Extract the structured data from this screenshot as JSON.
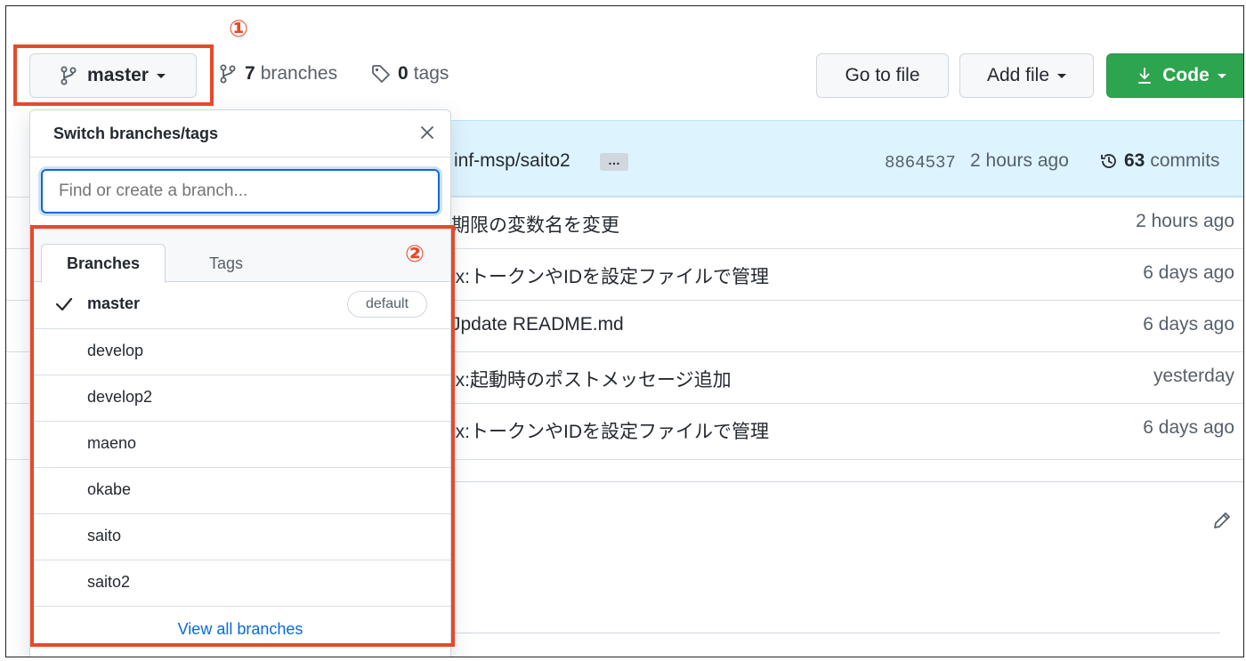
{
  "annotations": {
    "marker1": "①",
    "marker2": "②"
  },
  "repo_bar": {
    "branch_button": "master",
    "branches_count": "7",
    "branches_label": "branches",
    "tags_count": "0",
    "tags_label": "tags",
    "go_to_file": "Go to file",
    "add_file": "Add file",
    "code": "Code"
  },
  "latest_commit": {
    "author_branch": "inf-msp/saito2",
    "ellipsis": "…",
    "sha": "8864537",
    "time": "2 hours ago",
    "commits_count": "63",
    "commits_label": "commits"
  },
  "file_rows": [
    {
      "message": "期限の変数名を変更",
      "age": "2 hours ago"
    },
    {
      "message": "ix:トークンやIDを設定ファイルで管理",
      "age": "6 days ago"
    },
    {
      "message": "Jpdate README.md",
      "age": "6 days ago"
    },
    {
      "message": "ix:起動時のポストメッセージ追加",
      "age": "yesterday"
    },
    {
      "message": "ix:トークンやIDを設定ファイルで管理",
      "age": "6 days ago"
    }
  ],
  "dropdown": {
    "title": "Switch branches/tags",
    "search_placeholder": "Find or create a branch...",
    "tabs": [
      "Branches",
      "Tags"
    ],
    "branches": [
      "master",
      "develop",
      "develop2",
      "maeno",
      "okabe",
      "saito",
      "saito2"
    ],
    "default_label": "default",
    "view_all": "View all branches"
  },
  "colors": {
    "accent_red": "#e8482a",
    "code_green": "#2da44e",
    "link_blue": "#0969da"
  }
}
